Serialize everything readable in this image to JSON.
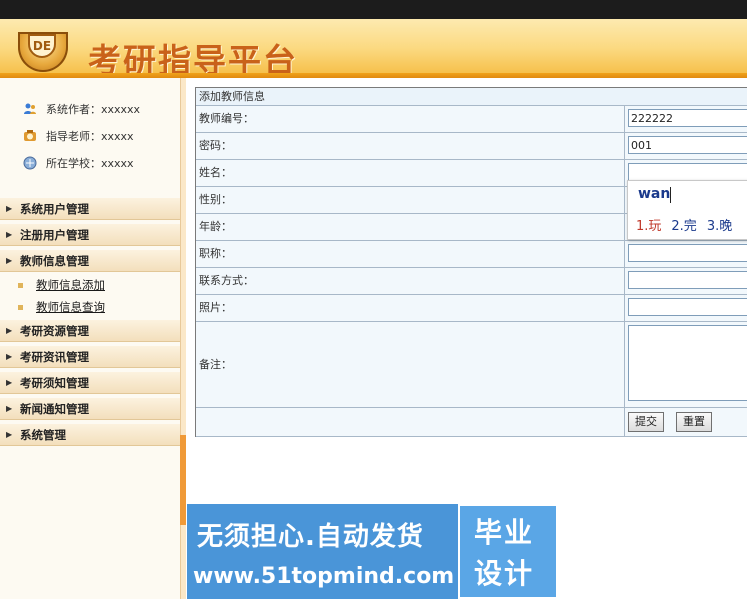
{
  "header": {
    "logo_text": "DE",
    "title": "考研指导平台"
  },
  "sidebar": {
    "info": [
      {
        "icon": "users-icon",
        "text": "系统作者：xxxxxx"
      },
      {
        "icon": "teacher-icon",
        "text": "指导老师：xxxxx"
      },
      {
        "icon": "school-icon",
        "text": "所在学校：xxxxx"
      }
    ],
    "menu": [
      {
        "label": "系统用户管理"
      },
      {
        "label": "注册用户管理"
      },
      {
        "label": "教师信息管理",
        "children": [
          {
            "label": "教师信息添加"
          },
          {
            "label": "教师信息查询"
          }
        ]
      },
      {
        "label": "考研资源管理"
      },
      {
        "label": "考研资讯管理"
      },
      {
        "label": "考研须知管理"
      },
      {
        "label": "新闻通知管理"
      },
      {
        "label": "系统管理"
      }
    ],
    "arrow_glyph": "▶",
    "collapse_glyph": "◀"
  },
  "form": {
    "title": "添加教师信息",
    "fields": [
      {
        "label": "教师编号：",
        "value": "222222"
      },
      {
        "label": "密码：",
        "value": "001"
      },
      {
        "label": "姓名：",
        "value": ""
      },
      {
        "label": "性别：",
        "value": ""
      },
      {
        "label": "年龄：",
        "value": ""
      },
      {
        "label": "职称：",
        "value": ""
      },
      {
        "label": "联系方式：",
        "value": ""
      },
      {
        "label": "照片：",
        "value": ""
      },
      {
        "label": "备注：",
        "value": ""
      }
    ],
    "submit_label": "提交",
    "reset_label": "重置"
  },
  "ime": {
    "composition": "wan",
    "candidates": [
      "1.玩",
      "2.完",
      "3.晚"
    ]
  },
  "watermark": {
    "line1": "无须担心.自动发货",
    "line2": "www.51topmind.com",
    "badge_line1": "毕业",
    "badge_line2": "设计"
  },
  "colors": {
    "header_text": "#c9621a",
    "header_bg": "#fbd980",
    "banner_bg": "#4a95d8"
  }
}
